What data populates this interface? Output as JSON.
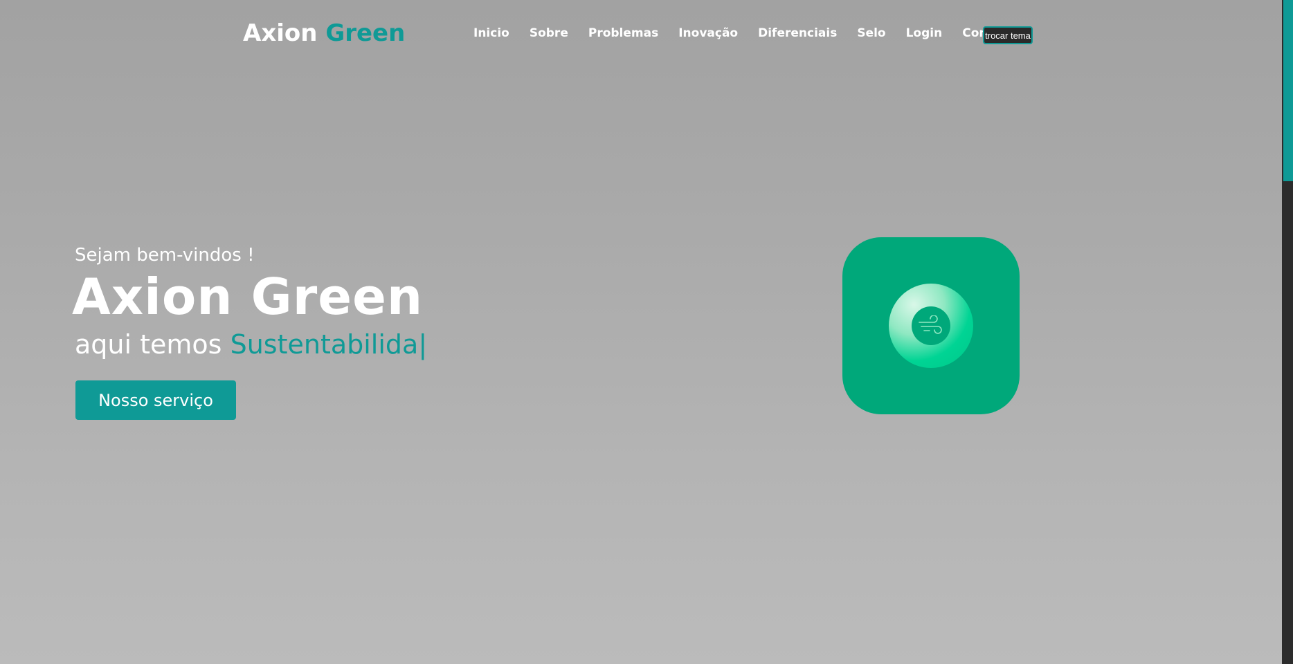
{
  "header": {
    "logo_main": "Axion",
    "logo_accent": "Green",
    "nav": [
      "Inicio",
      "Sobre",
      "Problemas",
      "Inovação",
      "Diferenciais",
      "Selo",
      "Login",
      "Contato"
    ],
    "theme_button": "trocar tema"
  },
  "hero": {
    "welcome": "Sejam bem-vindos !",
    "title": "Axion Green",
    "tagline_prefix": "aqui temos",
    "tagline_typed": "Sustentabilida",
    "tagline_cursor": "|",
    "cta_label": "Nosso serviço"
  },
  "icons": {
    "app_icon": "wind-icon"
  },
  "colors": {
    "accent": "#0f9a96",
    "app_icon_bg": "#00a87a",
    "ring": "#00d494"
  }
}
